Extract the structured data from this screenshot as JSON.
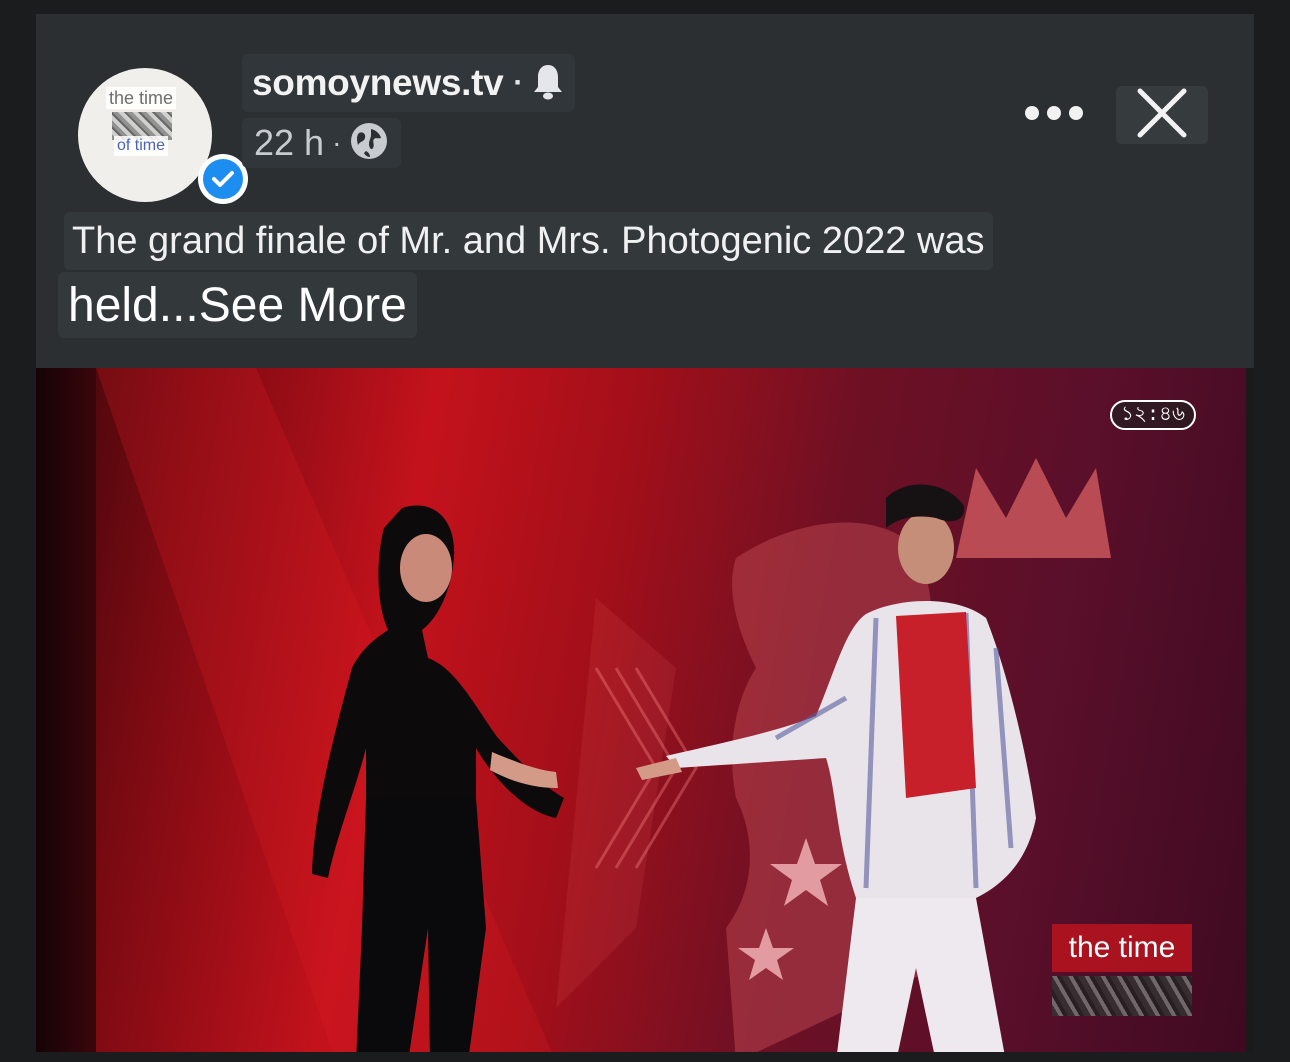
{
  "post": {
    "avatar": {
      "watermark_top": "the time",
      "watermark_bottom": "of time"
    },
    "page_name": "somoynews.tv",
    "name_separator": "·",
    "time_ago": "22 h",
    "meta_separator": "·",
    "privacy_icon": "globe-icon",
    "notify_icon": "bell-icon",
    "more_icon": "more-horizontal-icon",
    "close_icon": "close-icon",
    "caption_line1": "The grand finale of Mr. and Mrs. Photogenic 2022 was",
    "caption_line2": "held...See More"
  },
  "photo": {
    "timestamp": "১২:৪৬",
    "watermark": "the time"
  },
  "colors": {
    "background": "#2b2f31",
    "verified_badge": "#1d8ef0",
    "photo_red": "#c4121c"
  }
}
